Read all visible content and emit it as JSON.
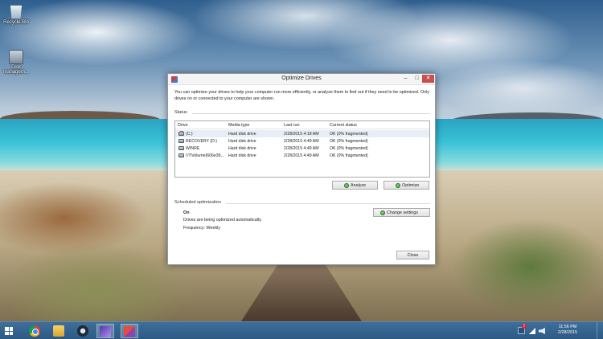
{
  "desktop": {
    "icons": [
      {
        "label": "Recycle Bin",
        "icon": "recycle-bin-icon"
      },
      {
        "label": "Disk managem...",
        "icon": "disk-management-icon"
      }
    ]
  },
  "window": {
    "title": "Optimize Drives",
    "controls": {
      "minimize": "–",
      "maximize": "□",
      "close": "✕"
    },
    "intro": "You can optimize your drives to help your computer run more efficiently, or analyze them to find out if they need to be optimized. Only drives on or connected to your computer are shown.",
    "status_label": "Status",
    "columns": [
      "Drive",
      "Media type",
      "Last run",
      "Current status"
    ],
    "drives": [
      {
        "drive": "(C:)",
        "media": "Hard disk drive",
        "last_run": "2/28/2015 4:18 AM",
        "status": "OK (0% fragmented)",
        "icon": "system-drive-icon"
      },
      {
        "drive": "RECOVERY (D:)",
        "media": "Hard disk drive",
        "last_run": "2/28/2015 4:49 AM",
        "status": "OK (0% fragmented)",
        "icon": "hard-drive-icon"
      },
      {
        "drive": "WINRE",
        "media": "Hard disk drive",
        "last_run": "2/28/2015 4:49 AM",
        "status": "OK (0% fragmented)",
        "icon": "hard-drive-icon"
      },
      {
        "drive": "\\\\?\\Volume{606e39...",
        "media": "Hard disk drive",
        "last_run": "2/28/2015 4:49 AM",
        "status": "OK (0% fragmented)",
        "icon": "hard-drive-icon"
      }
    ],
    "analyze_label": "Analyze",
    "optimize_label": "Optimize",
    "scheduled_label": "Scheduled optimization",
    "change_settings_label": "Change settings",
    "schedule_state": "On",
    "schedule_desc": "Drives are being optimized automatically.",
    "frequency": "Frequency: Weekly",
    "close_label": "Close"
  },
  "taskbar": {
    "apps": [
      "start-icon",
      "chrome-icon",
      "file-explorer-icon",
      "media-player-icon",
      "paint-icon",
      "optimize-drives-icon"
    ],
    "clock": {
      "time": "11:56 PM",
      "date": "2/28/2015"
    }
  }
}
